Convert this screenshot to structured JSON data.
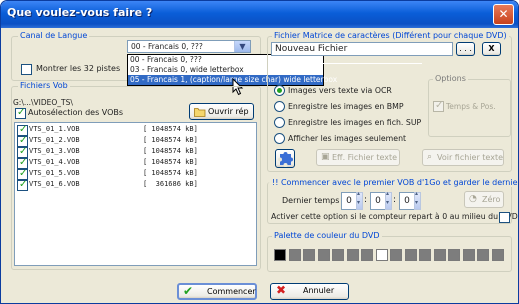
{
  "window": {
    "title": "Que voulez-vous faire ?",
    "close_icon": "close-icon"
  },
  "language": {
    "group_label": "Canal de Langue",
    "selected": "00 - Francais 0, ???",
    "options": [
      "00 - Francais 0, ???",
      "03 - Francais 0, wide letterbox",
      "05 - Francais 1, (caption/large size char) wide letterbox"
    ],
    "highlighted_index": 2,
    "show_32_label": "Montrer les 32 pistes",
    "show_32_checked": false
  },
  "vob": {
    "group_label": "Fichiers Vob",
    "path": "G:\\...\\VIDEO_TS\\",
    "auto_label": "Autosélection des VOBs",
    "auto_checked": true,
    "open_button": "Ouvrir rép",
    "files": [
      {
        "name": "VTS_01_1.VOB",
        "size": "[ 1048574 kB]",
        "checked": true
      },
      {
        "name": "VTS_01_2.VOB",
        "size": "[ 1048574 kB]",
        "checked": true
      },
      {
        "name": "VTS_01_3.VOB",
        "size": "[ 1048574 kB]",
        "checked": true
      },
      {
        "name": "VTS_01_4.VOB",
        "size": "[ 1048574 kB]",
        "checked": true
      },
      {
        "name": "VTS_01_5.VOB",
        "size": "[ 1048574 kB]",
        "checked": true
      },
      {
        "name": "VTS_01_6.VOB",
        "size": "[  361686 kB]",
        "checked": true
      }
    ]
  },
  "matrix": {
    "group_label": "Fichier Matrice de caractères (Différent pour chaque DVD)",
    "file_value": "Nouveau Fichier",
    "browse_label": ". . .",
    "clear_label": "X",
    "radios": [
      "Images vers texte via OCR",
      "Enregistre les images en BMP",
      "Enregistre les images en fich. SUP",
      "Afficher les images seulement"
    ],
    "radio_selected": 0,
    "options_label": "Options",
    "temps_label": "Temps & Pos.",
    "temps_checked": true,
    "eff_label": "Eff. Fichier texte",
    "voir_label": "Voir fichier texte"
  },
  "timing": {
    "header": "!! Commencer avec le premier VOB d'1Go et garder le dernier t",
    "dernier_label": "Dernier temps :",
    "h": "0",
    "m": "0",
    "s": "0",
    "zero_label": "Zéro",
    "activer_label": "Activer cette option si le compteur repart à 0 au milieu du DVD",
    "activer_checked": false
  },
  "palette": {
    "group_label": "Palette de couleur du DVD",
    "colors": [
      "#000000",
      "#7d7d7d",
      "#7d7d7d",
      "#7d7d7d",
      "#7d7d7d",
      "#7d7d7d",
      "#7d7d7d",
      "#ffffff",
      "#7d7d7d",
      "#7d7d7d",
      "#7d7d7d",
      "#7d7d7d",
      "#7d7d7d",
      "#7d7d7d",
      "#7d7d7d",
      "#7d7d7d"
    ]
  },
  "footer": {
    "ok_label": "Commencer",
    "cancel_label": "Annuler",
    "ok_icon": "check-icon",
    "cancel_icon": "red-x-icon"
  }
}
